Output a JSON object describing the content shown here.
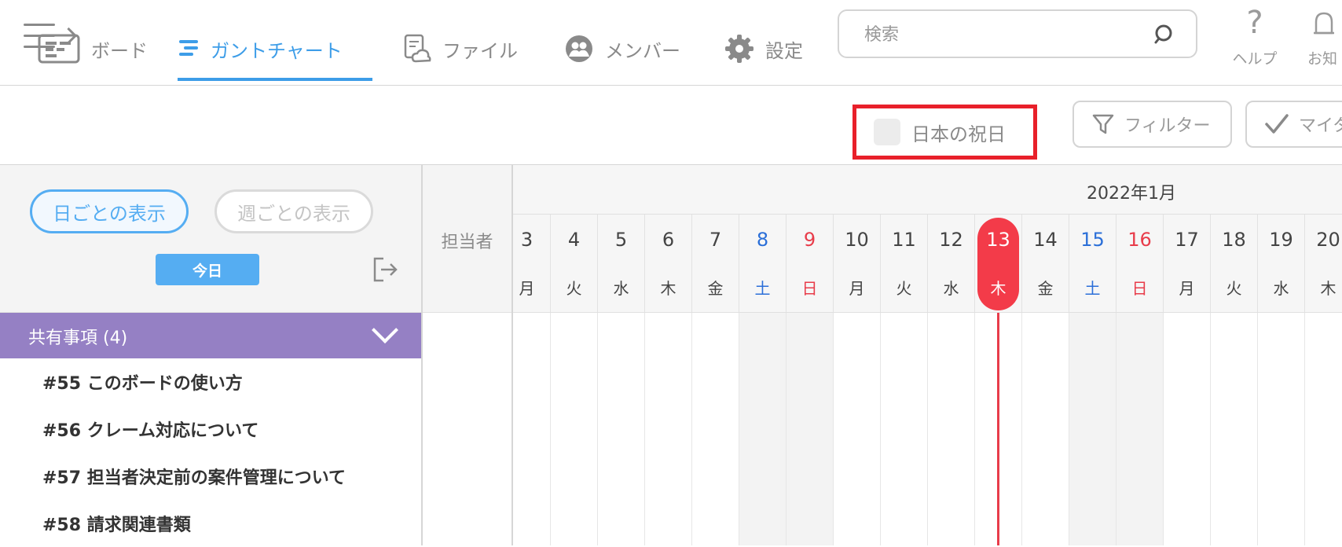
{
  "header": {
    "search_placeholder": "検索",
    "help_label": "ヘルプ",
    "notify_label": "お知"
  },
  "tabs": [
    {
      "label": "ボード",
      "icon": "board-icon",
      "active": false
    },
    {
      "label": "ガントチャート",
      "icon": "gantt-icon",
      "active": true
    },
    {
      "label": "ファイル",
      "icon": "file-icon",
      "active": false
    },
    {
      "label": "メンバー",
      "icon": "members-icon",
      "active": false
    },
    {
      "label": "設定",
      "icon": "gear-icon",
      "active": false
    }
  ],
  "holiday_toggle": {
    "label": "日本の祝日",
    "checked": false
  },
  "filter_button": {
    "label": "フィルター"
  },
  "my_button": {
    "label": "マイタ"
  },
  "view_controls": {
    "daily": "日ごとの表示",
    "weekly": "週ごとの表示",
    "today": "今日"
  },
  "assignee_header": "担当者",
  "group": {
    "title": "共有事項 (4)"
  },
  "tasks": [
    {
      "label": "#55 このボードの使い方"
    },
    {
      "label": "#56 クレーム対応について"
    },
    {
      "label": "#57 担当者決定前の案件管理について"
    },
    {
      "label": "#58 請求関連書類"
    }
  ],
  "calendar": {
    "month": "2022年1月",
    "days": [
      {
        "d": "3",
        "w": "月",
        "type": "weekday"
      },
      {
        "d": "4",
        "w": "火",
        "type": "weekday"
      },
      {
        "d": "5",
        "w": "水",
        "type": "weekday"
      },
      {
        "d": "6",
        "w": "木",
        "type": "weekday"
      },
      {
        "d": "7",
        "w": "金",
        "type": "weekday"
      },
      {
        "d": "8",
        "w": "土",
        "type": "sat"
      },
      {
        "d": "9",
        "w": "日",
        "type": "sun"
      },
      {
        "d": "10",
        "w": "月",
        "type": "weekday"
      },
      {
        "d": "11",
        "w": "火",
        "type": "weekday"
      },
      {
        "d": "12",
        "w": "水",
        "type": "weekday"
      },
      {
        "d": "13",
        "w": "木",
        "type": "today"
      },
      {
        "d": "14",
        "w": "金",
        "type": "weekday"
      },
      {
        "d": "15",
        "w": "土",
        "type": "sat"
      },
      {
        "d": "16",
        "w": "日",
        "type": "sun"
      },
      {
        "d": "17",
        "w": "月",
        "type": "weekday"
      },
      {
        "d": "18",
        "w": "火",
        "type": "weekday"
      },
      {
        "d": "19",
        "w": "水",
        "type": "weekday"
      },
      {
        "d": "20",
        "w": "木",
        "type": "weekday"
      }
    ]
  },
  "colors": {
    "accent": "#3d9de8",
    "group_header": "#9580c4",
    "today": "#f33b49",
    "saturday": "#2b6fd8",
    "sunday": "#e83c4a",
    "highlight_border": "#e8202a"
  }
}
